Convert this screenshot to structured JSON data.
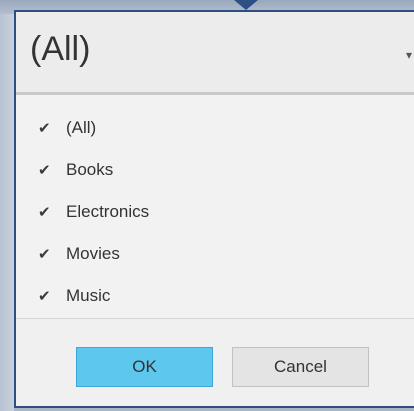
{
  "filter": {
    "selected_value": "(All)",
    "items": [
      {
        "label": "(All)",
        "checked": true
      },
      {
        "label": "Books",
        "checked": true
      },
      {
        "label": "Electronics",
        "checked": true
      },
      {
        "label": "Movies",
        "checked": true
      },
      {
        "label": "Music",
        "checked": true
      }
    ],
    "check_glyph": "✔"
  },
  "buttons": {
    "ok_label": "OK",
    "cancel_label": "Cancel"
  },
  "colors": {
    "accent": "#5ec7ee",
    "border": "#2e4d80"
  }
}
